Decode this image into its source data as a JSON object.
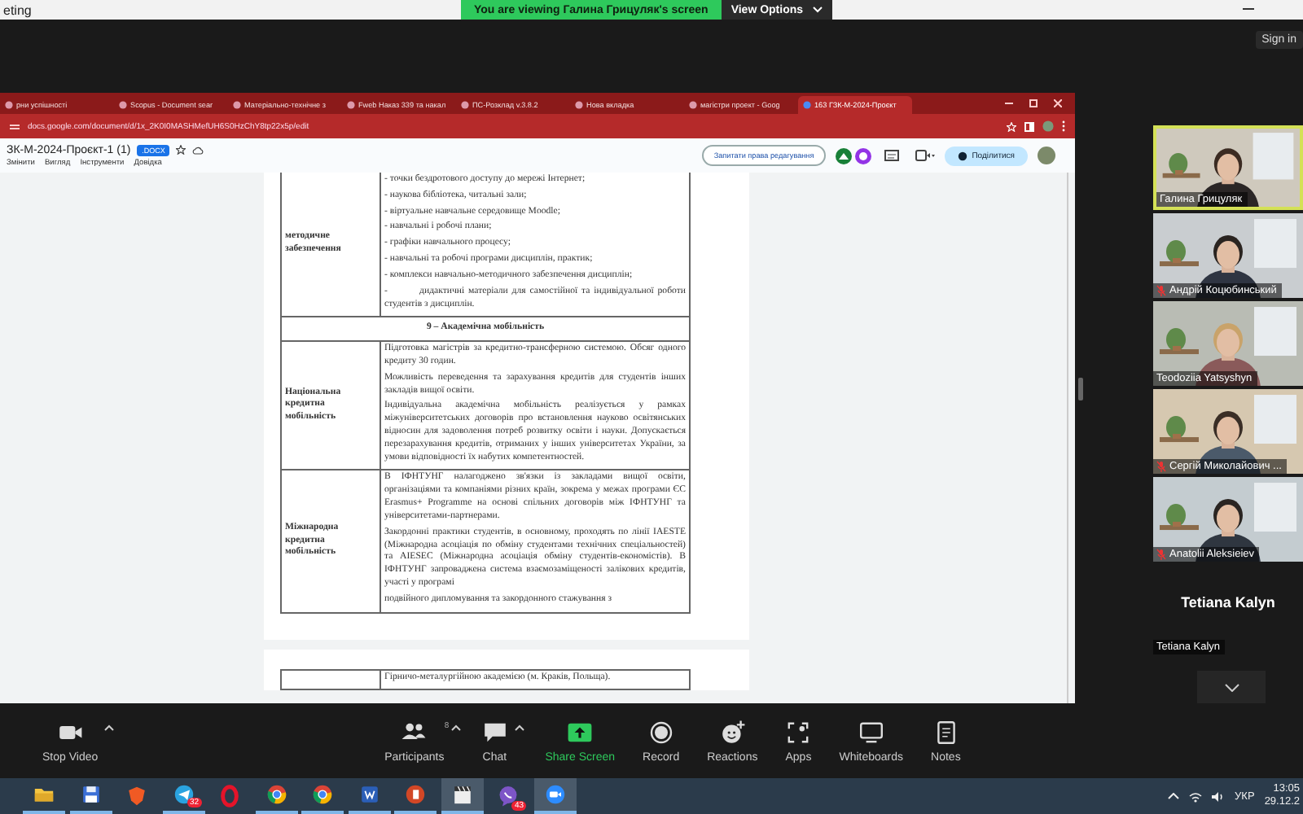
{
  "zoom_title": "eting",
  "share_banner": {
    "text": "You are viewing Галина Грицуляк's screen",
    "view_options": "View Options"
  },
  "sign_in": "Sign in",
  "browser": {
    "tabs": [
      {
        "title": "рни успішності",
        "selected": false
      },
      {
        "title": "Scopus - Document sear",
        "selected": false
      },
      {
        "title": "Матеріально-технічне з",
        "selected": false
      },
      {
        "title": "Fweb Наказ 339 та накал",
        "selected": false
      },
      {
        "title": "ПС-Розклад v.3.8.2",
        "selected": false
      },
      {
        "title": "Нова вкладка",
        "selected": false
      },
      {
        "title": "магістри проект - Goog",
        "selected": false
      },
      {
        "title": "163 ГЗК-М-2024-Проєкт",
        "selected": true
      }
    ],
    "url": "docs.google.com/document/d/1x_2K0I0MASHMefUH6S0HzChY8tp22x5p/edit",
    "doc_title": "ЗК-М-2024-Проєкт-1 (1)",
    "doc_badge": ".DOCX",
    "menu": [
      "Змінити",
      "Вигляд",
      "Інструменти",
      "Довідка"
    ],
    "request_edit": "Запитати права редагування",
    "share": "Поділитися"
  },
  "document": {
    "rows": [
      {
        "kind": "split",
        "label": "методичне забезпечення",
        "paragraphs": [
          "- точки бездротового доступу до мережі Інтернет;",
          "- наукова бібліотека, читальні зали;",
          "- віртуальне навчальне середовище Moodle;",
          "- навчальні і робочі плани;",
          "- графіки навчального процесу;",
          "- навчальні та робочі програми дисциплін, практик;",
          "- комплекси навчально-методичного забезпечення дисциплін;",
          "-        дидактичні матеріали для самостійної та індивідуальної роботи студентів з дисциплін."
        ]
      },
      {
        "kind": "header",
        "text": "9 – Академічна мобільність"
      },
      {
        "kind": "split",
        "label": "Національна кредитна мобільність",
        "paragraphs": [
          "Підготовка магістрів за кредитно-трансферною системою. Обсяг одного кредиту 30 годин.",
          "Можливість переведення та зарахування кредитів для студентів інших закладів вищої освіти.",
          "Індивідуальна академічна мобільність реалізується у рамках міжуніверситетських договорів про встановлення науково освітянських відносин для задоволення потреб розвитку освіти і науки. Допускається перезарахування кредитів, отриманих у інших університетах України, за умови відповідності їх набутих компетентностей."
        ]
      },
      {
        "kind": "split",
        "label": "Міжнародна кредитна мобільність",
        "paragraphs": [
          "В ІФНТУНГ налагоджено зв'язки із закладами вищої освіти, організаціями та компаніями різних країн, зокрема у межах програми ЄС Erasmus+ Programme на основі спільних договорів між ІФНТУНГ та університетами-партнерами.",
          "Закордонні практики студентів, в основному, проходять по лінії IAESTE (Міжнародна асоціація по обміну студентами технічних спеціальностей) та AIESEC (Міжнародна асоціація обміну студентів-економістів). В ІФНТУНГ запроваджена система взаємозаміщеності залікових кредитів, участі у програмі",
          "подвійного дипломування та закордонного стажування з"
        ]
      }
    ],
    "next_page_rows": [
      {
        "kind": "split",
        "paragraphs": [
          "Гірничо-металургійною академією (м. Краків, Польща)."
        ]
      }
    ]
  },
  "participants": [
    {
      "name": "Галина Грицуляк",
      "kind": "video",
      "muted": false,
      "speaking": true
    },
    {
      "name": "Андрій Коцюбинський",
      "kind": "video",
      "muted": true,
      "speaking": false
    },
    {
      "name": "Teodoziia Yatsyshyn",
      "kind": "video",
      "muted": false,
      "speaking": false
    },
    {
      "name": "Сергій Миколайович ...",
      "kind": "video",
      "muted": true,
      "speaking": false
    },
    {
      "name": "Anatolii Aleksieiev",
      "kind": "video",
      "muted": true,
      "speaking": false
    },
    {
      "name": "Tetiana Kalyn",
      "display_name": "Tetiana Kalyn",
      "kind": "avatar",
      "muted": false,
      "speaking": false
    }
  ],
  "toolbar": [
    {
      "label": "Stop Video",
      "kind": "video",
      "caret": true
    },
    {
      "label": "Participants",
      "kind": "participants",
      "count": "8",
      "caret": true
    },
    {
      "label": "Chat",
      "kind": "chat",
      "caret": true
    },
    {
      "label": "Share Screen",
      "kind": "share",
      "caret": false
    },
    {
      "label": "Record",
      "kind": "record",
      "caret": false
    },
    {
      "label": "Reactions",
      "kind": "reactions",
      "caret": false
    },
    {
      "label": "Apps",
      "kind": "apps",
      "caret": false
    },
    {
      "label": "Whiteboards",
      "kind": "whiteboards",
      "caret": false
    },
    {
      "label": "Notes",
      "kind": "notes",
      "caret": false
    }
  ],
  "taskbar": {
    "apps": [
      {
        "kind": "folder",
        "running": true,
        "active": false
      },
      {
        "kind": "floppy",
        "running": true,
        "active": false
      },
      {
        "kind": "shield",
        "running": false,
        "active": false
      },
      {
        "kind": "plane",
        "running": true,
        "active": false,
        "badge": "32"
      },
      {
        "kind": "ring",
        "running": false,
        "active": false
      },
      {
        "kind": "chrome",
        "running": true,
        "active": false
      },
      {
        "kind": "chrome",
        "running": true,
        "active": false
      },
      {
        "kind": "word",
        "running": true,
        "active": false
      },
      {
        "kind": "slides",
        "running": true,
        "active": false
      },
      {
        "kind": "clapper",
        "running": true,
        "active": true
      },
      {
        "kind": "chat",
        "running": false,
        "active": false,
        "badge": "43"
      },
      {
        "kind": "zoom",
        "running": true,
        "active": true
      }
    ],
    "language": "УКР",
    "time": "13:05",
    "date": "29.12.2"
  }
}
